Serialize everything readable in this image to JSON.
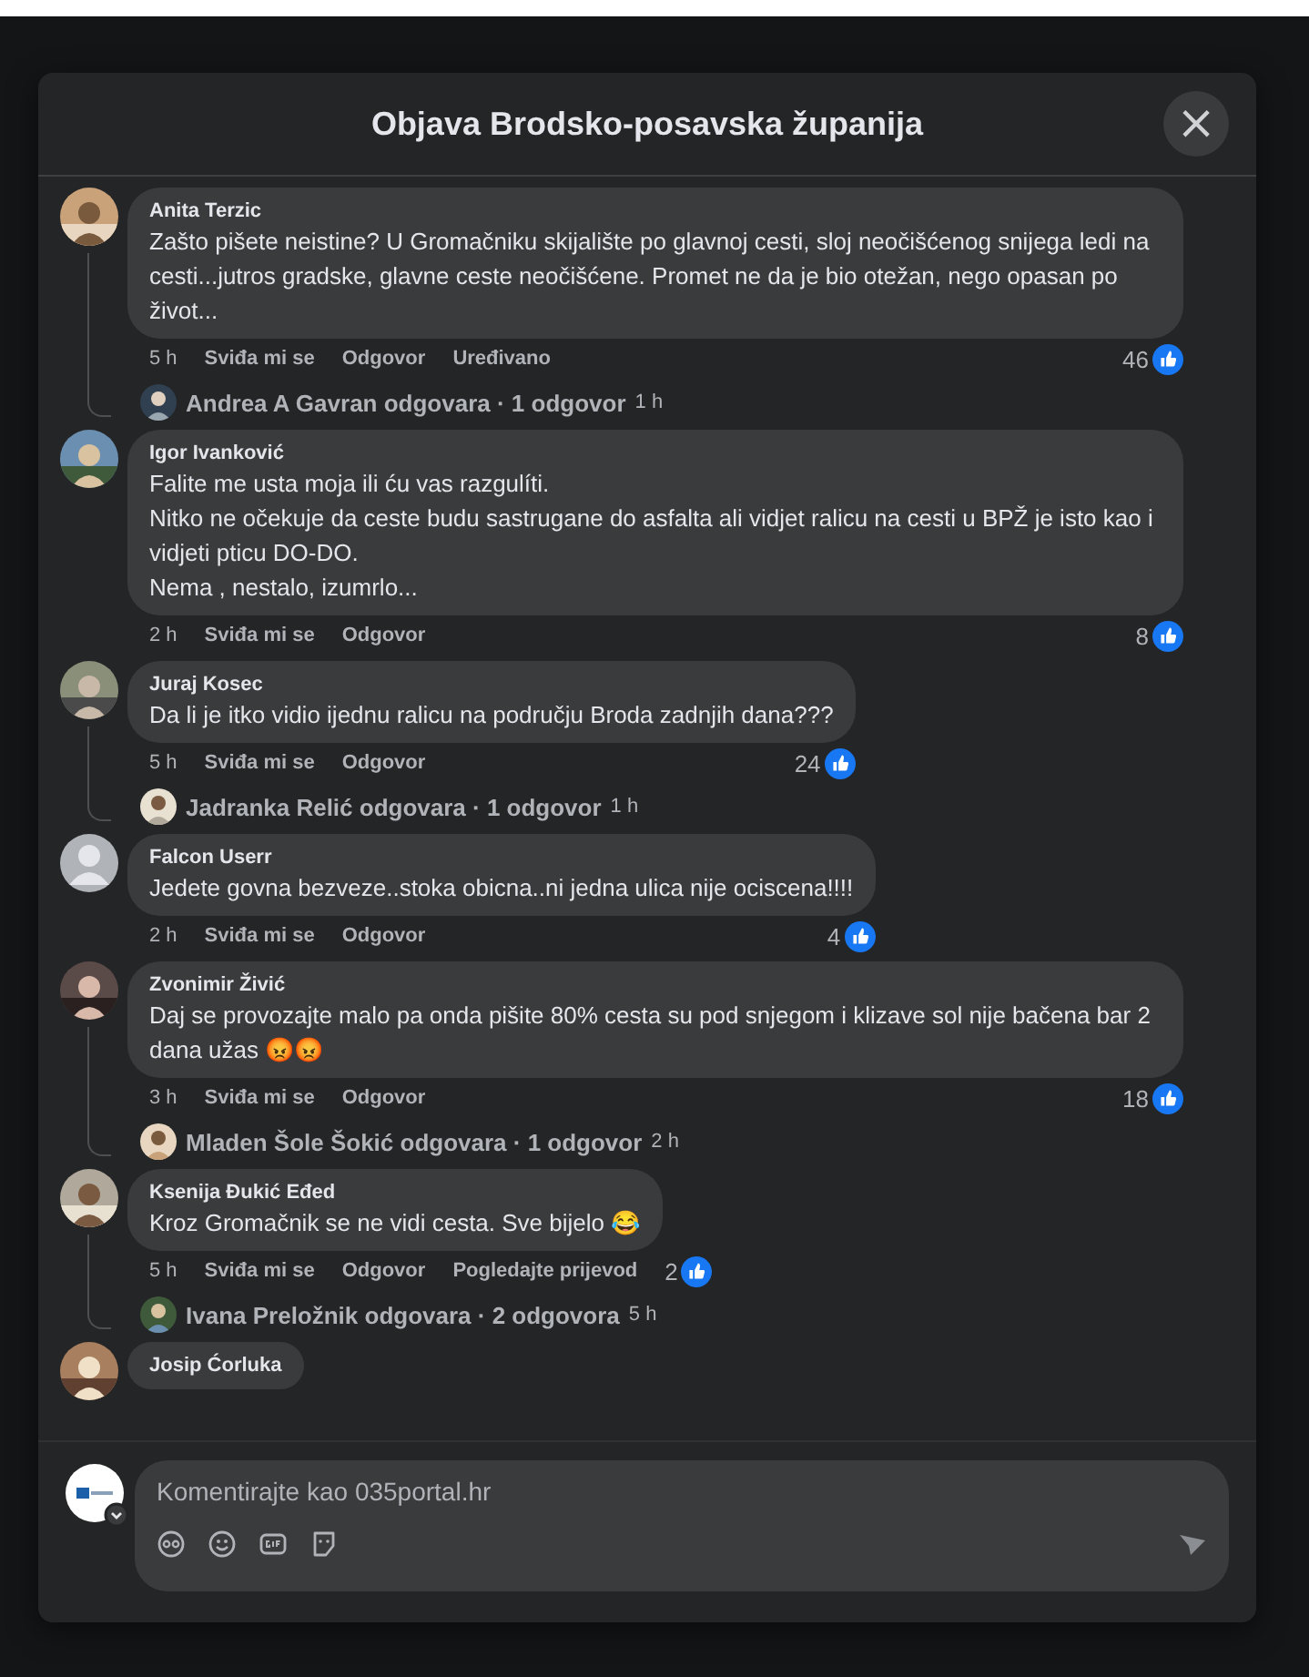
{
  "dialog": {
    "title": "Objava Brodsko-posavska županija",
    "close": "×"
  },
  "comments": [
    {
      "author": "Anita Terzic",
      "avatar": {
        "kind": "picture"
      },
      "text": "Zašto pišete neistine? U Gromačniku skijalište po glavnoj cesti, sloj neočišćenog snijega ledi na cesti...jutros gradske, glavne ceste neočišćene. Promet ne da je bio otežan, nego opasan po život...",
      "time": "5 h",
      "actions": [
        "Sviđa mi se",
        "Odgovor",
        "Uređivano"
      ],
      "likes": "46",
      "reply": {
        "text": "Andrea A Gavran odgovara · 1 odgovor",
        "time": "1 h"
      }
    },
    {
      "author": "Igor Ivanković",
      "avatar": {
        "kind": "picture"
      },
      "text": "Falite me usta moja ili ću vas razgulíti.\nNitko ne očekuje da ceste budu sastrugane do asfalta ali vidjet ralicu na cesti u BPŽ je isto kao i vidjeti pticu DO-DO.\nNema , nestalo, izumrlo...",
      "time": "2 h",
      "actions": [
        "Sviđa mi se",
        "Odgovor"
      ],
      "likes": "8"
    },
    {
      "author": "Juraj Kosec",
      "avatar": {
        "kind": "picture"
      },
      "text": "Da li je itko vidio ijednu ralicu na području Broda zadnjih dana???",
      "time": "5 h",
      "actions": [
        "Sviđa mi se",
        "Odgovor"
      ],
      "likes": "24",
      "reply": {
        "text": "Jadranka Relić odgovara · 1 odgovor",
        "time": "1 h"
      }
    },
    {
      "author": "Falcon Userr",
      "avatar": {
        "kind": "silhouette"
      },
      "text": "Jedete govna bezveze..stoka obicna..ni jedna ulica nije ociscena!!!!",
      "time": "2 h",
      "actions": [
        "Sviđa mi se",
        "Odgovor"
      ],
      "likes": "4"
    },
    {
      "author": "Zvonimir Živić",
      "avatar": {
        "kind": "picture"
      },
      "text": "Daj se provozajte malo pa onda pišite 80% cesta su pod snjegom i klizave sol nije bačena bar 2 dana užas 😡😡",
      "time": "3 h",
      "actions": [
        "Sviđa mi se",
        "Odgovor"
      ],
      "likes": "18",
      "reply": {
        "text": "Mladen Šole Šokić odgovara · 1 odgovor",
        "time": "2 h"
      }
    },
    {
      "author": "Ksenija Đukić Eđed",
      "avatar": {
        "kind": "picture"
      },
      "text": "Kroz Gromačnik se ne vidi cesta. Sve bijelo 😂",
      "time": "5 h",
      "actions": [
        "Sviđa mi se",
        "Odgovor",
        "Pogledajte prijevod"
      ],
      "likes": "2",
      "reply": {
        "text": "Ivana Preložnik odgovara · 2 odgovora",
        "time": "5 h"
      }
    },
    {
      "author": "Josip Ćorluka",
      "avatar": {
        "kind": "picture"
      }
    }
  ],
  "composer": {
    "placeholder": "Komentirajte kao 035portal.hr"
  }
}
